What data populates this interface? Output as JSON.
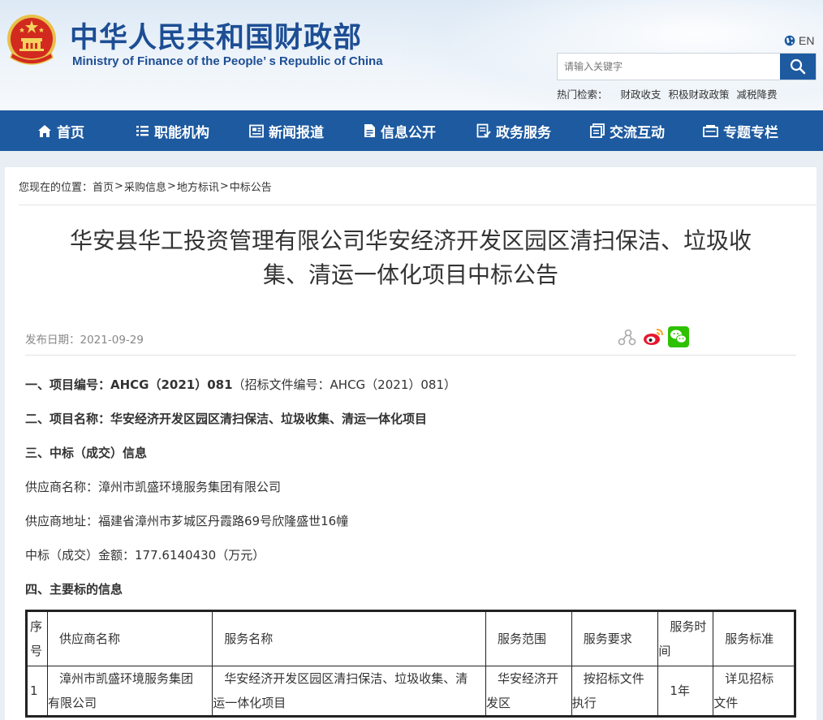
{
  "site": {
    "title_cn": "中华人民共和国财政部",
    "title_en": "Ministry of Finance of the People’ s Republic of China",
    "lang_label": "EN"
  },
  "search": {
    "placeholder": "请输入关键字",
    "hot_label": "热门检索：",
    "hot_keywords": [
      "财政收支",
      "积极财政政策",
      "减税降费"
    ]
  },
  "nav": [
    {
      "label": "首页",
      "icon": "home-icon"
    },
    {
      "label": "职能机构",
      "icon": "list-icon"
    },
    {
      "label": "新闻报道",
      "icon": "newspaper-icon"
    },
    {
      "label": "信息公开",
      "icon": "document-icon"
    },
    {
      "label": "政务服务",
      "icon": "checklist-icon"
    },
    {
      "label": "交流互动",
      "icon": "notes-icon"
    },
    {
      "label": "专题专栏",
      "icon": "window-icon"
    }
  ],
  "breadcrumb": {
    "prefix": "您现在的位置：",
    "items": [
      "首页",
      "采购信息",
      "地方标讯",
      "中标公告"
    ],
    "separator": ">"
  },
  "article": {
    "title_line1": "华安县华工投资管理有限公司华安经济开发区园区清扫保洁、垃圾收",
    "title_line2": "集、清运一体化项目中标公告",
    "date_label": "发布日期：",
    "date": "2021-09-29",
    "share_icons": [
      "share-icon",
      "weibo-icon",
      "wechat-icon"
    ],
    "p1_bold": "一、项目编号：AHCG（2021）081",
    "p1_normal": "（招标文件编号：AHCG（2021）081）",
    "p2": "二、项目名称：华安经济开发区园区清扫保洁、垃圾收集、清运一体化项目",
    "p3": "三、中标（成交）信息",
    "p4": "供应商名称：漳州市凯盛环境服务集团有限公司",
    "p5": "供应商地址：福建省漳州市芗城区丹霞路69号欣隆盛世16幢",
    "p6": "中标（成交）金额：177.6140430（万元）",
    "p7": "四、主要标的信息"
  },
  "table": {
    "headers": {
      "seq_a": "序",
      "seq_b": "号",
      "supplier": "供应商名称",
      "service": "服务名称",
      "scope": "服务范围",
      "req": "服务要求",
      "time_a": "服务时",
      "time_b": "间",
      "standard": "服务标准"
    },
    "row1": {
      "seq": "1",
      "supplier_a": "漳州市凯盛环境服务集团",
      "supplier_b": "有限公司",
      "service_a": "华安经济开发区园区清扫保洁、垃圾收集、清",
      "service_b": "运一体化项目",
      "scope_a": "华安经济开",
      "scope_b": "发区",
      "req_a": "按招标文件",
      "req_b": "执行",
      "time": "1年",
      "standard_a": "详见招标",
      "standard_b": "文件"
    }
  },
  "colors": {
    "brand_blue": "#1d5aa0",
    "title_blue": "#1d4e94",
    "page_bg": "#e9eef5"
  }
}
